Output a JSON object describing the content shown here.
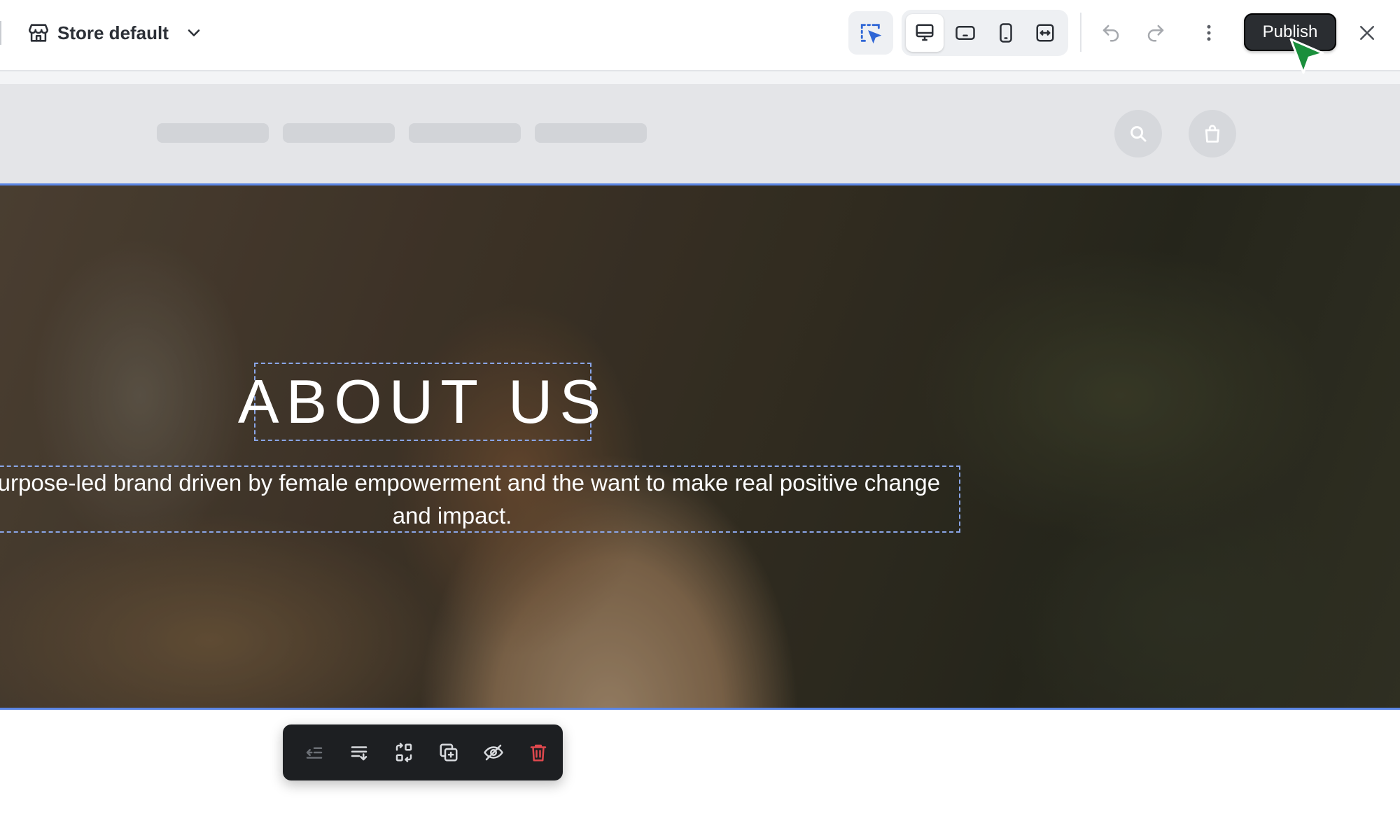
{
  "toolbar": {
    "store_label": "Store default",
    "publish_label": "Publish",
    "icons": [
      "store-icon",
      "chevron-down-icon",
      "select-cursor-icon",
      "desktop-icon",
      "tablet-landscape-icon",
      "mobile-icon",
      "fit-width-icon",
      "undo-icon",
      "redo-icon",
      "more-vertical-icon",
      "close-icon"
    ]
  },
  "hero": {
    "title": "ABOUT US",
    "text": "A purpose-led brand driven by female empowerment and the want to make real positive change and impact."
  },
  "action_bar": {
    "icons": [
      "outdent-icon",
      "wrap-text-icon",
      "swap-icon",
      "duplicate-icon",
      "hide-icon",
      "delete-icon"
    ]
  },
  "colors": {
    "selection_outline": "#5b86e5",
    "publish_bg": "#2a2d31",
    "delete_red": "#e0484e",
    "cursor_green": "#1a8f3c"
  }
}
